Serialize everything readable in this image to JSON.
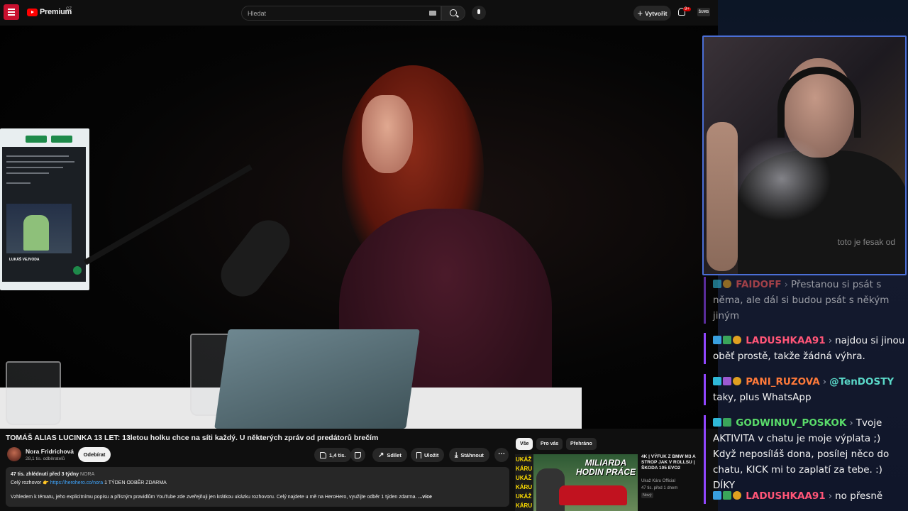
{
  "topbar": {
    "logo_text": "Premium",
    "logo_region": "CZ",
    "search_placeholder": "Hledat",
    "create_label": "Vytvořit",
    "notifications_count": "9+",
    "avatar_text": "ŠUMS"
  },
  "monitor": {
    "name_text": "LUKÁŠ VEJVODA"
  },
  "video": {
    "title": "TOMÁŠ ALIAS LUCINKA 13 LET: 13letou holku chce na síti každý. U některých zpráv od predátorů brečím",
    "channel_name": "Nora Fridrichová",
    "subscribers": "28,1 tis. odběratelů",
    "subscribe_label": "Odebírat",
    "likes": "1,4 tis.",
    "share_label": "Sdílet",
    "save_label": "Uložit",
    "download_label": "Stáhnout"
  },
  "description": {
    "meta": "47 tis. zhlédnutí  před 3 týdny",
    "tag": "NORA",
    "line1_prefix": "Celý rozhovor 👉 ",
    "line1_link": "https://herohero.co/nora",
    "line1_suffix": " 1 TÝDEN ODBĚR ZDARMA",
    "line2": "Vzhledem k tématu, jeho explicitnímu popisu a přísným pravidlům YouTube zde zveřejňuji jen krátkou ukázku rozhovoru. Celý najdete u mě na HeroHero, využijte odběr 1 týden zdarma.",
    "more_label": "...více"
  },
  "chips": [
    "Vše",
    "Pro vás",
    "Přehráno"
  ],
  "recommendation": {
    "thumb_side": [
      "UKÁŽ",
      "KÁRU",
      "UKÁŽ",
      "KÁRU",
      "UKÁŽ",
      "KÁRU"
    ],
    "thumb_title": "MILIARDA HODIN PRÁCE",
    "title": "4K | VÝFUK Z BMW M3 A STROP JAK V ROLLSU | ŠKODA 105 EVO2",
    "channel": "Ukaž Káru Official",
    "stats": "47 tis.  před 1 dnem",
    "badge": "Nový"
  },
  "webcam": {
    "overlay_text": "toto je fesak od"
  },
  "chat": [
    {
      "user": "FAIDOFF",
      "text": "Přestanou si psát s něma, ale dál si budou psát s někým jiným"
    },
    {
      "user": "LADUSHKAA91",
      "text": "najdou si jinou oběť prostě, takže žádná výhra."
    },
    {
      "user": "PANI_RUZOVA",
      "mention": "@TenDOSTY",
      "text": "taky, plus WhatsApp"
    },
    {
      "user": "GODWINUV_POSKOK",
      "text": "Tvoje AKTIVITA v chatu je moje výplata ;) Když neposíláš dona, posílej něco do chatu, KICK mi to zaplatí za tebe. :) DÍKY"
    },
    {
      "user": "LADUSHKAA91",
      "text": "no přesně"
    }
  ]
}
